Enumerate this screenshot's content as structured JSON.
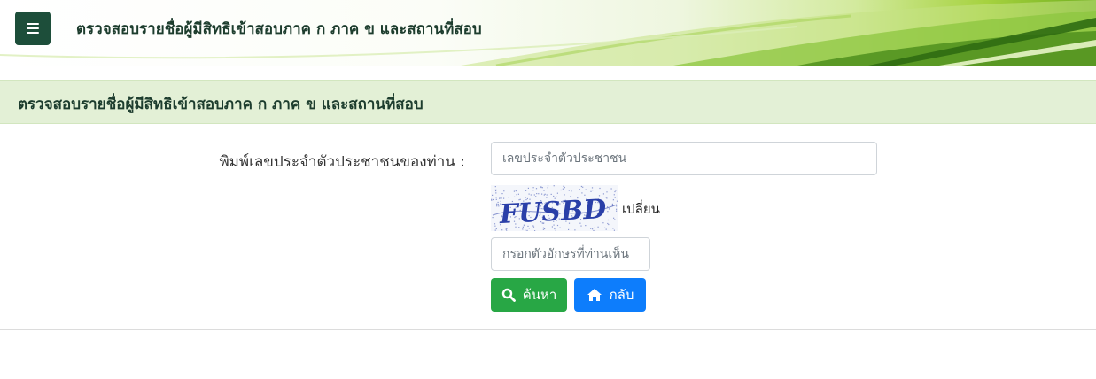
{
  "banner": {
    "title": "ตรวจสอบรายชื่อผู้มีสิทธิเข้าสอบภาค ก ภาค ข และสถานที่สอบ",
    "menu_icon": "bars-icon"
  },
  "section": {
    "title": "ตรวจสอบรายชื่อผู้มีสิทธิเข้าสอบภาค ก ภาค ข และสถานที่สอบ"
  },
  "form": {
    "idcard_label": "พิมพ์เลขประจำตัวประชาชนของท่าน :",
    "idcard_value": "",
    "idcard_placeholder": "เลขประจำตัวประชาชน",
    "captcha_text": "FUSBD",
    "change_label": "เปลี่ยน",
    "captcha_value": "",
    "captcha_placeholder": "กรอกตัวอักษรที่ท่านเห็น"
  },
  "buttons": {
    "search_label": "ค้นหา",
    "search_icon": "search-icon",
    "back_label": "กลับ",
    "back_icon": "home-icon"
  },
  "colors": {
    "menu_button": "#1d4e3a",
    "header_band": "#e3f0d6",
    "search_button": "#28a745",
    "back_button": "#0d7dfc"
  }
}
